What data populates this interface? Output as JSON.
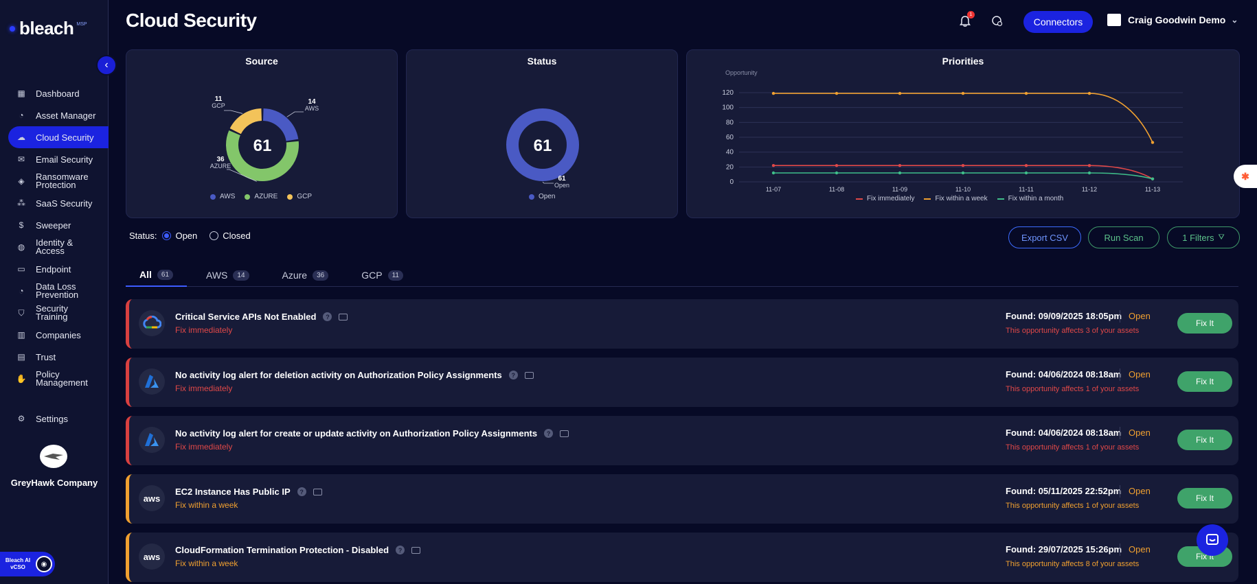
{
  "brand": {
    "name": "bleach",
    "badge": "MSP"
  },
  "sidebar": {
    "items": [
      {
        "label": "Dashboard",
        "icon": "grid-icon"
      },
      {
        "label": "Asset Manager",
        "icon": "pie-icon"
      },
      {
        "label": "Cloud Security",
        "icon": "cloud-icon",
        "active": true
      },
      {
        "label": "Email Security",
        "icon": "mail-icon"
      },
      {
        "label": "Ransomware Protection",
        "icon": "ransomware-icon"
      },
      {
        "label": "SaaS Security",
        "icon": "saas-icon"
      },
      {
        "label": "Sweeper",
        "icon": "sweeper-icon"
      },
      {
        "label": "Identity & Access",
        "icon": "people-icon"
      },
      {
        "label": "Endpoint",
        "icon": "monitor-icon"
      },
      {
        "label": "Data Loss Prevention",
        "icon": "dlp-icon"
      },
      {
        "label": "Security Training",
        "icon": "shield-icon"
      },
      {
        "label": "Companies",
        "icon": "building-icon"
      },
      {
        "label": "Trust",
        "icon": "document-icon"
      },
      {
        "label": "Policy Management",
        "icon": "policy-icon"
      }
    ],
    "settings": "Settings",
    "company_name": "GreyHawk Company",
    "ai_button": "Bleach AI vCSO"
  },
  "header": {
    "title": "Cloud Security",
    "notification_count": "1",
    "connectors": "Connectors",
    "user": "Craig Goodwin Demo"
  },
  "source_card": {
    "title": "Source",
    "total": "61",
    "slices": [
      {
        "label": "AWS",
        "value": 14,
        "value_text": "14",
        "color": "#4a5ac4"
      },
      {
        "label": "AZURE",
        "value": 36,
        "value_text": "36",
        "color": "#83c66a"
      },
      {
        "label": "GCP",
        "value": 11,
        "value_text": "11",
        "color": "#f3c35a"
      }
    ],
    "legend": [
      "AWS",
      "AZURE",
      "GCP"
    ]
  },
  "status_card": {
    "title": "Status",
    "total": "61",
    "slices": [
      {
        "label": "Open",
        "value": 61,
        "value_text": "61",
        "color": "#4a5ac4"
      }
    ],
    "legend": [
      "Open"
    ]
  },
  "chart_data": {
    "type": "line",
    "title": "Priorities",
    "ylabel": "Opportunity",
    "xlabel": "",
    "categories": [
      "11-07",
      "11-08",
      "11-09",
      "11-10",
      "11-11",
      "11-12",
      "11-13"
    ],
    "yticks": [
      "0",
      "20",
      "40",
      "60",
      "80",
      "100",
      "120"
    ],
    "ylim": [
      0,
      130
    ],
    "grid": true,
    "legend_position": "bottom",
    "series": [
      {
        "name": "Fix immediately",
        "color": "#e04848",
        "values": [
          22,
          22,
          22,
          22,
          22,
          22,
          4
        ]
      },
      {
        "name": "Fix within a week",
        "color": "#f0a030",
        "values": [
          119,
          119,
          119,
          119,
          119,
          119,
          53
        ]
      },
      {
        "name": "Fix within a month",
        "color": "#3fbf8a",
        "values": [
          12,
          12,
          12,
          12,
          12,
          12,
          4
        ]
      }
    ]
  },
  "filters": {
    "status_label": "Status:",
    "open": "Open",
    "closed": "Closed",
    "export": "Export CSV",
    "run_scan": "Run Scan",
    "filters": "1 Filters"
  },
  "tabs": [
    {
      "label": "All",
      "count": "61"
    },
    {
      "label": "AWS",
      "count": "14"
    },
    {
      "label": "Azure",
      "count": "36"
    },
    {
      "label": "GCP",
      "count": "11"
    }
  ],
  "findings": [
    {
      "provider": "GCP",
      "logo": "gcp-logo",
      "title": "Critical Service APIs Not Enabled",
      "priority": "Fix immediately",
      "level": "immediate",
      "found": "Found: 09/09/2025 18:05pm",
      "status": "Open",
      "affects": "This opportunity affects 3 of your assets",
      "action": "Fix It"
    },
    {
      "provider": "A",
      "logo": "azure-logo",
      "title": "No activity log alert for deletion activity on Authorization Policy Assignments",
      "priority": "Fix immediately",
      "level": "immediate",
      "found": "Found: 04/06/2024 08:18am",
      "status": "Open",
      "affects": "This opportunity affects 1 of your assets",
      "action": "Fix It"
    },
    {
      "provider": "A",
      "logo": "azure-logo",
      "title": "No activity log alert for create or update activity on Authorization Policy Assignments",
      "priority": "Fix immediately",
      "level": "immediate",
      "found": "Found: 04/06/2024 08:18am",
      "status": "Open",
      "affects": "This opportunity affects 1 of your assets",
      "action": "Fix It"
    },
    {
      "provider": "aws",
      "logo": "aws-logo",
      "title": "EC2 Instance Has Public IP",
      "priority": "Fix within a week",
      "level": "week",
      "found": "Found: 05/11/2025 22:52pm",
      "status": "Open",
      "affects": "This opportunity affects 1 of your assets",
      "action": "Fix It"
    },
    {
      "provider": "aws",
      "logo": "aws-logo",
      "title": "CloudFormation Termination Protection - Disabled",
      "priority": "Fix within a week",
      "level": "week",
      "found": "Found: 29/07/2025 15:26pm",
      "status": "Open",
      "affects": "This opportunity affects 8 of your assets",
      "action": "Fix It"
    }
  ]
}
